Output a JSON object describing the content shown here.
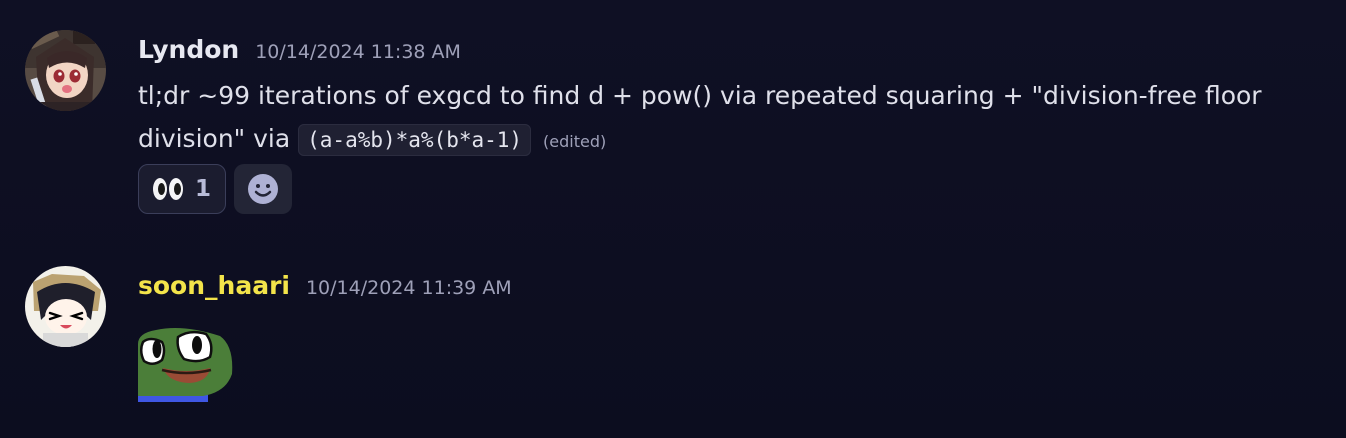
{
  "theme": {
    "background": "#0d0e20",
    "text": "#dfe0ea",
    "muted": "#9ea0b8",
    "username_default": "#e7e8f1",
    "username_highlight": "#f3e44a",
    "code_background": "#1f2032",
    "reaction_background": "#1b1c2f",
    "reaction_border": "#3b3e5a"
  },
  "messages": [
    {
      "username": "Lyndon",
      "timestamp": "10/14/2024 11:38 AM",
      "avatar_icon": "anime-witch-avatar-icon",
      "text": "tl;dr ~99 iterations of exgcd to find d + pow() via repeated squaring + \"division-free floor division\" via",
      "code": "(a-a%b)*a%(b*a-1)",
      "edited": "(edited)",
      "reaction": {
        "emoji": "eyes-emoji",
        "count": "1"
      },
      "add_reaction_icon": "smiley-icon"
    },
    {
      "username": "soon_haari",
      "timestamp": "10/14/2024 11:39 AM",
      "avatar_icon": "anime-girl-avatar-icon",
      "sticker": "pepe-eyes-sticker"
    }
  ]
}
